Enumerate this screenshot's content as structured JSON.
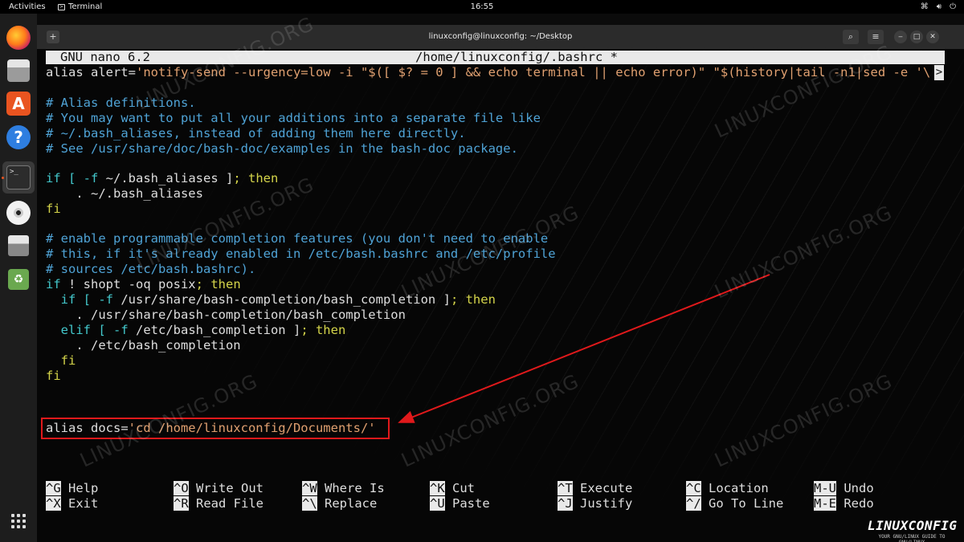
{
  "topbar": {
    "activities": "Activities",
    "app_name": "Terminal",
    "clock": "16:55"
  },
  "window": {
    "title": "linuxconfig@linuxconfig: ~/Desktop"
  },
  "nano": {
    "version": "GNU nano 6.2",
    "filename": "/home/linuxconfig/.bashrc *",
    "lines": {
      "l1_a": "alias alert=",
      "l1_b": "'notify-send --urgency=low -i \"$([ $? = 0 ] && echo terminal || echo error)\" \"$(history|tail -n1|sed -e '\\",
      "l1_trunc": ">",
      "l3": "# Alias definitions.",
      "l4": "# You may want to put all your additions into a separate file like",
      "l5": "# ~/.bash_aliases, instead of adding them here directly.",
      "l6": "# See /usr/share/doc/bash-doc/examples in the bash-doc package.",
      "l8_a": "if [ ",
      "l8_b": "-f",
      "l8_c": " ~/.bash_aliases ]",
      "l8_d": "; then",
      "l9": "    . ~/.bash_aliases",
      "l10": "fi",
      "l12": "# enable programmable completion features (you don't need to enable",
      "l13": "# this, if it's already enabled in /etc/bash.bashrc and /etc/profile",
      "l14": "# sources /etc/bash.bashrc).",
      "l15_a": "if",
      "l15_b": " ! shopt -oq posix",
      "l15_c": "; then",
      "l16_a": "  if",
      "l16_b": " [ ",
      "l16_c": "-f",
      "l16_d": " /usr/share/bash-completion/bash_completion ]",
      "l16_e": "; then",
      "l17": "    . /usr/share/bash-completion/bash_completion",
      "l18_a": "  elif",
      "l18_b": " [ ",
      "l18_c": "-f",
      "l18_d": " /etc/bash_completion ]",
      "l18_e": "; then",
      "l19": "    . /etc/bash_completion",
      "l20": "  fi",
      "l21": "fi",
      "l23_a": "alias docs=",
      "l23_b": "'cd /home/linuxconfig/Documents/'"
    },
    "shortcuts": [
      {
        "key": "^G",
        "label": "Help"
      },
      {
        "key": "^O",
        "label": "Write Out"
      },
      {
        "key": "^W",
        "label": "Where Is"
      },
      {
        "key": "^K",
        "label": "Cut"
      },
      {
        "key": "^T",
        "label": "Execute"
      },
      {
        "key": "^C",
        "label": "Location"
      },
      {
        "key": "M-U",
        "label": "Undo"
      },
      {
        "key": "^X",
        "label": "Exit"
      },
      {
        "key": "^R",
        "label": "Read File"
      },
      {
        "key": "^\\",
        "label": "Replace"
      },
      {
        "key": "^U",
        "label": "Paste"
      },
      {
        "key": "^J",
        "label": "Justify"
      },
      {
        "key": "^/",
        "label": "Go To Line"
      },
      {
        "key": "M-E",
        "label": "Redo"
      }
    ]
  },
  "watermark": "LINUXCONFIG.ORG",
  "logo": {
    "name": "LINUXCONFIG",
    "tagline": "YOUR GNU/LINUX GUIDE TO GNU/LINUX"
  },
  "colors": {
    "comment": "#4fa3d6",
    "keyword": "#d4d44a",
    "string": "#e0a070",
    "annotation": "#e0191b"
  }
}
